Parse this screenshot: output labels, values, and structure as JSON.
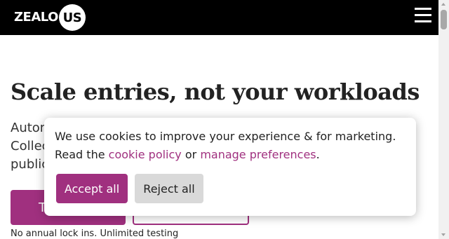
{
  "header": {
    "logo_text": "ZEALO",
    "logo_badge": "US",
    "menu_icon": "hamburger-menu-icon"
  },
  "hero": {
    "title": "Scale entries, not your workloads",
    "description": "Autom Collec public",
    "primary_cta": "T",
    "secondary_cta": "",
    "note": "No annual lock ins. Unlimited testing"
  },
  "cookie_banner": {
    "text_part1": "We use cookies to improve your experience & for marketing. Read the ",
    "link1": "cookie policy",
    "text_part2": " or ",
    "link2": "manage preferences",
    "text_part3": ".",
    "accept_label": "Accept all",
    "reject_label": "Reject all"
  },
  "colors": {
    "brand": "#a0307f",
    "header_bg": "#000000",
    "reject_bg": "#d9d9d9"
  }
}
